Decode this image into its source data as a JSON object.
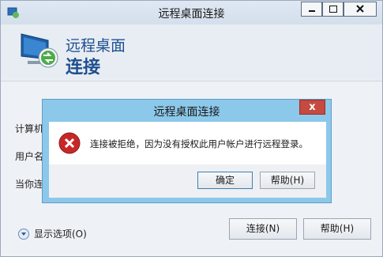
{
  "window": {
    "title": "远程桌面连接",
    "controls": {
      "minimize": "minimize",
      "maximize": "maximize",
      "close": "close"
    }
  },
  "header": {
    "line1": "远程桌面",
    "line2": "连接"
  },
  "form": {
    "computer_label": "计算机",
    "user_label": "用户名",
    "note_label": "当你连"
  },
  "footer": {
    "show_options": "显示选项(O)",
    "connect": "连接(N)",
    "help": "帮助(H)"
  },
  "dialog": {
    "title": "远程桌面连接",
    "close": "x",
    "message": "连接被拒绝，因为没有授权此用户帐户进行远程登录。",
    "ok": "确定",
    "help": "帮助(H)"
  },
  "colors": {
    "header_text": "#1f4f90",
    "dialog_frame": "#8cc8ea",
    "close_red": "#c54a3f",
    "error_red": "#c62828"
  },
  "icons": [
    "rdp-app-icon",
    "monitor-icon",
    "error-icon",
    "chevron-down-icon"
  ]
}
